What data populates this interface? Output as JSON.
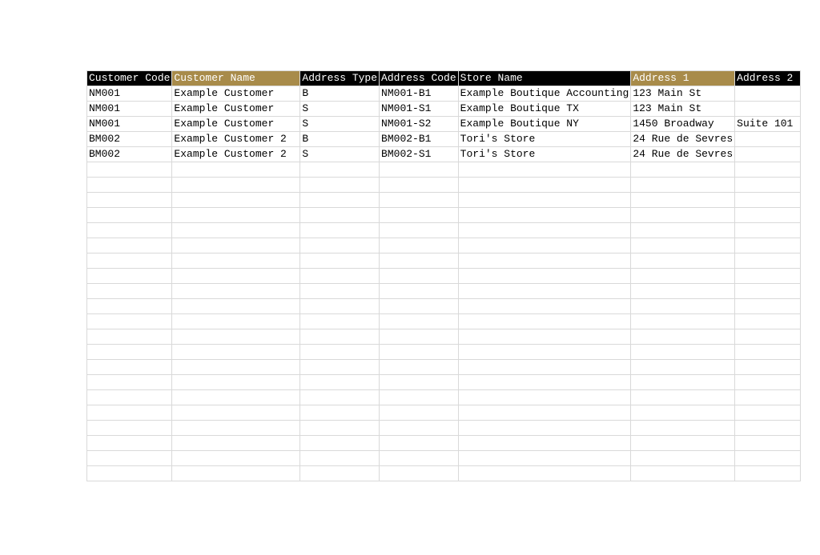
{
  "columns": [
    {
      "label": "Customer Code",
      "variant": "black"
    },
    {
      "label": "Customer Name",
      "variant": "gold"
    },
    {
      "label": "Address Type",
      "variant": "black"
    },
    {
      "label": "Address Code",
      "variant": "black"
    },
    {
      "label": "Store Name",
      "variant": "black"
    },
    {
      "label": "Address 1",
      "variant": "gold"
    },
    {
      "label": "Address 2",
      "variant": "black"
    }
  ],
  "rows": [
    {
      "cells": [
        "NM001",
        "Example Customer",
        "B",
        "NM001-B1",
        "Example Boutique Accounting",
        "123 Main St",
        ""
      ]
    },
    {
      "cells": [
        "NM001",
        "Example Customer",
        "S",
        "NM001-S1",
        "Example Boutique TX",
        "123 Main St",
        ""
      ]
    },
    {
      "cells": [
        "NM001",
        "Example Customer",
        "S",
        "NM001-S2",
        "Example Boutique NY",
        "1450 Broadway",
        "Suite 101"
      ]
    },
    {
      "cells": [
        "BM002",
        "Example Customer 2",
        "B",
        "BM002-B1",
        "Tori's Store",
        "24 Rue de Sevres",
        ""
      ]
    },
    {
      "cells": [
        "BM002",
        "Example Customer 2",
        "S",
        "BM002-S1",
        "Tori's Store",
        "24 Rue de Sevres",
        ""
      ]
    }
  ],
  "empty_row_count": 21
}
